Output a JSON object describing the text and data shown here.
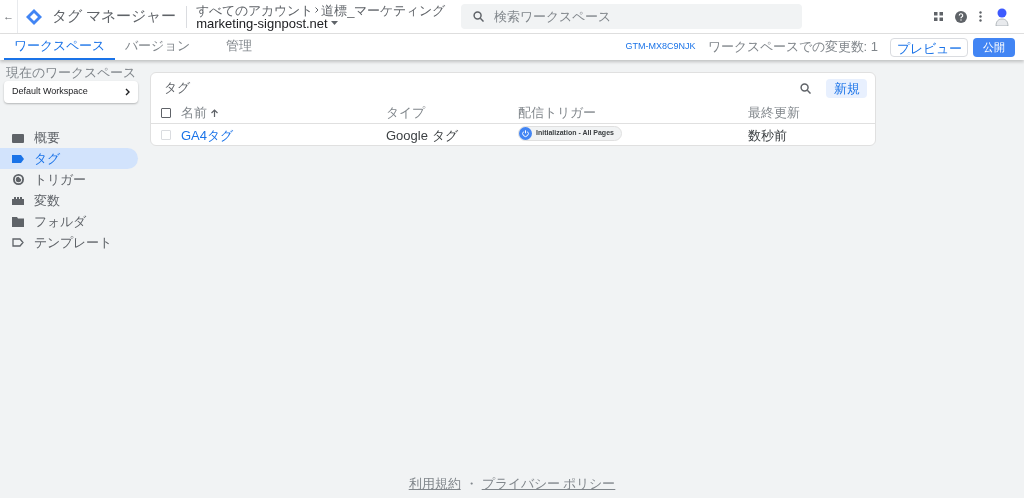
{
  "app": {
    "back": "←",
    "title": "タグ マネージャー",
    "breadcrumb": [
      "すべてのアカウント",
      "道標_マーケティング"
    ],
    "container": "marketing-signpost.net",
    "search": {
      "placeholder": "検索ワークスペース"
    }
  },
  "tabs": [
    {
      "label": "ワークスペース",
      "selected": true
    },
    {
      "label": "バージョン",
      "selected": false
    },
    {
      "label": "管理",
      "selected": false
    }
  ],
  "toolbar": {
    "container_id": "GTM-MX8C9NJK",
    "changes": "ワークスペースでの変更数: 1",
    "preview": "プレビュー",
    "publish": "公開"
  },
  "sidebar": {
    "workspace_label": "現在のワークスペース",
    "workspace": "Default Workspace",
    "items": [
      {
        "label": "概要",
        "selected": false
      },
      {
        "label": "タグ",
        "selected": true
      },
      {
        "label": "トリガー",
        "selected": false
      },
      {
        "label": "変数",
        "selected": false
      },
      {
        "label": "フォルダ",
        "selected": false
      },
      {
        "label": "テンプレート",
        "selected": false
      }
    ]
  },
  "table": {
    "title": "タグ",
    "new_button": "新規",
    "all_checked": false,
    "columns": [
      "名前",
      "タイプ",
      "配信トリガー",
      "最終更新"
    ],
    "rows": [
      {
        "name": "GA4タグ",
        "type": "Google タグ",
        "trigger": "Initialization - All Pages",
        "updated": "数秒前",
        "checked": false
      }
    ]
  },
  "footer": {
    "terms": "利用規約",
    "separator": "・",
    "privacy": "プライバシー ポリシー"
  }
}
